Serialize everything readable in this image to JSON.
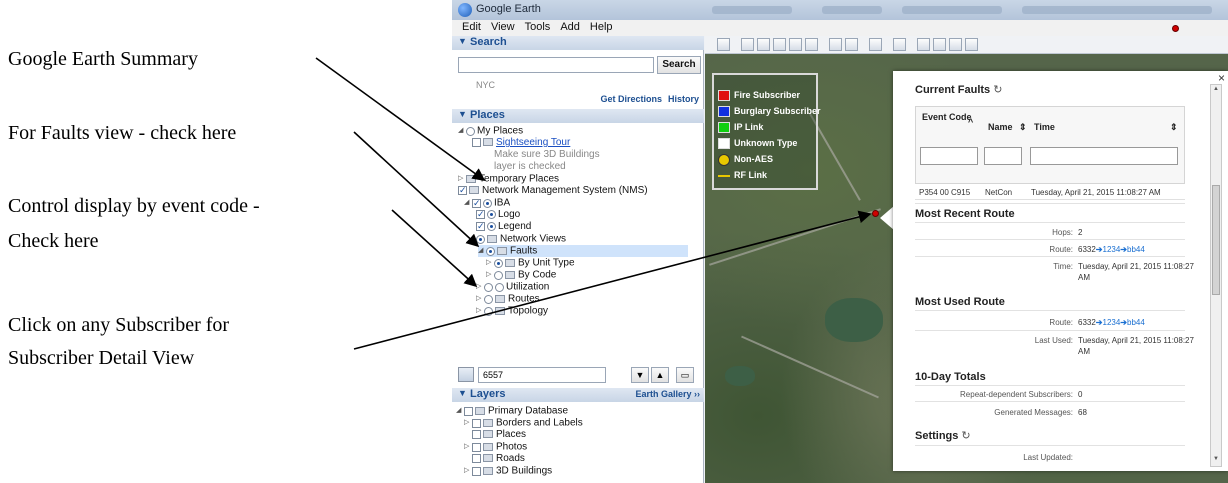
{
  "annotations": [
    {
      "text": "Google Earth Summary"
    },
    {
      "text": "For Faults view - check here"
    },
    {
      "text": "Control display by event code -"
    },
    {
      "text": "Check here"
    },
    {
      "text": "Click on any Subscriber for"
    },
    {
      "text": "Subscriber Detail View"
    }
  ],
  "window": {
    "title": "Google Earth"
  },
  "menu": [
    "Edit",
    "View",
    "Tools",
    "Add",
    "Help"
  ],
  "search": {
    "header": "Search",
    "button": "Search",
    "hint": "NYC",
    "get_directions": "Get Directions",
    "history": "History"
  },
  "places": {
    "header": "Places",
    "items": [
      {
        "label": "My Places"
      },
      {
        "label": "Sightseeing Tour"
      },
      {
        "label": "Make sure 3D Buildings"
      },
      {
        "label": "layer is checked"
      },
      {
        "label": "Temporary Places"
      },
      {
        "label": "Network Management System (NMS)"
      },
      {
        "label": "IBA"
      },
      {
        "label": "Logo"
      },
      {
        "label": "Legend"
      },
      {
        "label": "Network Views"
      },
      {
        "label": "Faults"
      },
      {
        "label": "By Unit Type"
      },
      {
        "label": "By Code"
      },
      {
        "label": "Utilization"
      },
      {
        "label": "Routes"
      },
      {
        "label": "Topology"
      }
    ],
    "search_value": "6557"
  },
  "layers": {
    "header": "Layers",
    "gallery": "Earth Gallery ››",
    "items": [
      {
        "label": "Primary Database"
      },
      {
        "label": "Borders and Labels"
      },
      {
        "label": "Places"
      },
      {
        "label": "Photos"
      },
      {
        "label": "Roads"
      },
      {
        "label": "3D Buildings"
      }
    ]
  },
  "legend": {
    "items": [
      {
        "label": "Fire Subscriber",
        "color": "#e01010"
      },
      {
        "label": "Burglary Subscriber",
        "color": "#1030e0"
      },
      {
        "label": "IP Link",
        "color": "#10d010"
      },
      {
        "label": "Unknown Type",
        "color": "#ffffff"
      },
      {
        "label": "Non-AES",
        "color": "#e8c800"
      },
      {
        "label": "RF Link",
        "color": "#e8c800"
      }
    ]
  },
  "popup": {
    "current_faults": "Current Faults",
    "col_event_code": "Event Code",
    "col_event_code_sort": "^",
    "col_name": "Name",
    "col_name_sort": "⇕",
    "col_time": "Time",
    "col_time_sort": "⇕",
    "fault": {
      "code": "P354 00 C915",
      "name": "NetCon",
      "time": "Tuesday, April 21, 2015 11:08:27 AM"
    },
    "most_recent_route": "Most Recent Route",
    "hops_label": "Hops:",
    "hops_value": "2",
    "route_label": "Route:",
    "route_start": "6332",
    "route_mid": "1234",
    "route_end": "bb44",
    "route_arrow": "➔",
    "time_label": "Time:",
    "time_value_1": "Tuesday, April 21, 2015 11:08:27",
    "time_value_2": "AM",
    "most_used_route": "Most Used Route",
    "used_route_label": "Route:",
    "last_used_label": "Last Used:",
    "last_used_1": "Tuesday, April 21, 2015 11:08:27",
    "last_used_2": "AM",
    "ten_day_totals": "10-Day Totals",
    "repeat_label": "Repeat-dependent Subscribers:",
    "repeat_value": "0",
    "generated_label": "Generated Messages:",
    "generated_value": "68",
    "settings": "Settings",
    "last_updated_label": "Last Updated:",
    "close": "×",
    "refresh_icon": "↻"
  }
}
